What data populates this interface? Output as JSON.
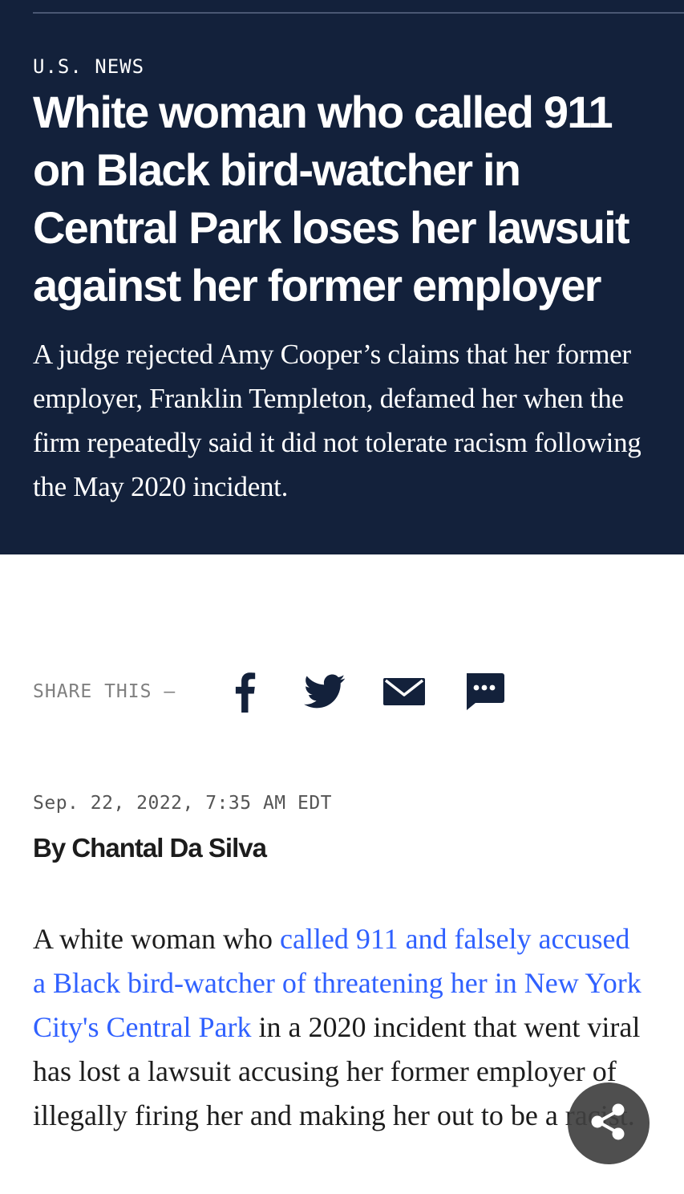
{
  "header": {
    "section": "U.S. NEWS",
    "headline": "White woman who called 911 on Black bird-watcher in Central Park loses her lawsuit against her former employer",
    "dek": "A judge rejected Amy Cooper’s claims that her former employer, Franklin Templeton, defamed her when the firm repeatedly said it did not tolerate racism following the May 2020 incident."
  },
  "share": {
    "label": "SHARE THIS —",
    "icons": [
      "facebook-icon",
      "twitter-icon",
      "email-icon",
      "sms-icon"
    ]
  },
  "meta": {
    "date": "Sep. 22, 2022, 7:35 AM EDT",
    "byline": "By Chantal Da Silva"
  },
  "article": {
    "p1_before": "A white woman who ",
    "p1_link": "called 911 and falsely accused a Black bird-watcher of threatening her in New York City's Central Park",
    "p1_after": " in a 2020 incident that went viral has lost a lawsuit accusing her former employer of illegally firing her and making her out to be a racist."
  },
  "floating_share": {
    "icon": "share-icon"
  },
  "colors": {
    "hero_background": "#13213b",
    "link": "#3061ff",
    "text": "#1c1c1c"
  }
}
